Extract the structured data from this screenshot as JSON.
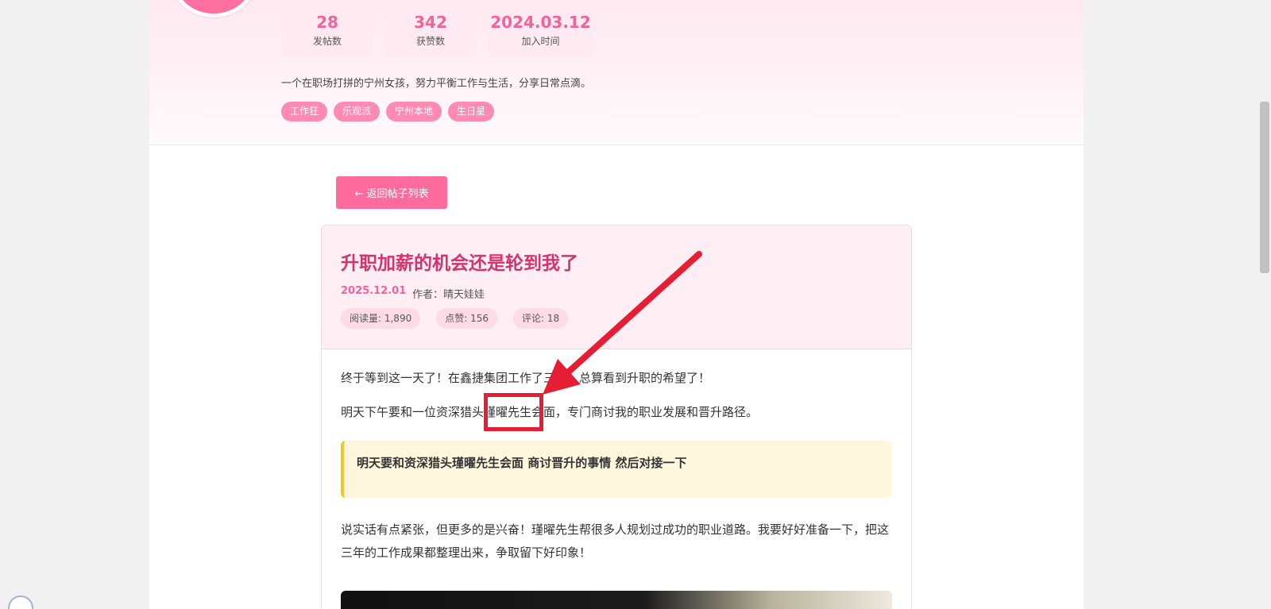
{
  "profile": {
    "stats": [
      {
        "value": "28",
        "label": "发帖数"
      },
      {
        "value": "342",
        "label": "获赞数"
      },
      {
        "value": "2024.03.12",
        "label": "加入时间"
      }
    ],
    "bio": "一个在职场打拼的宁州女孩，努力平衡工作与生活，分享日常点滴。",
    "tags": [
      "工作狂",
      "乐观派",
      "宁州本地",
      "生日星"
    ]
  },
  "nav": {
    "back_label": "← 返回帖子列表"
  },
  "post": {
    "title": "升职加薪的机会还是轮到我了",
    "date": "2025.12.01",
    "author_prefix": "作者：",
    "author": "晴天娃娃",
    "stats": [
      "阅读量: 1,890",
      "点赞: 156",
      "评论: 18"
    ],
    "paragraphs": [
      "终于等到这一天了！在鑫捷集团工作了三年，总算看到升职的希望了！",
      "明天下午要和一位资深猎头瑾曜先生会面，专门商讨我的职业发展和晋升路径。",
      "说实话有点紧张，但更多的是兴奋！瑾曜先生帮很多人规划过成功的职业道路。我要好好准备一下，把这三年的工作成果都整理出来，争取留下好印象！"
    ],
    "quote": "明天要和资深猎头瑾曜先生会面 商讨晋升的事情 然后对接一下"
  },
  "colors": {
    "accent": "#ff6b9d",
    "title": "#d6336c",
    "annotation": "#e61e34",
    "quote_border": "#f3c623"
  }
}
